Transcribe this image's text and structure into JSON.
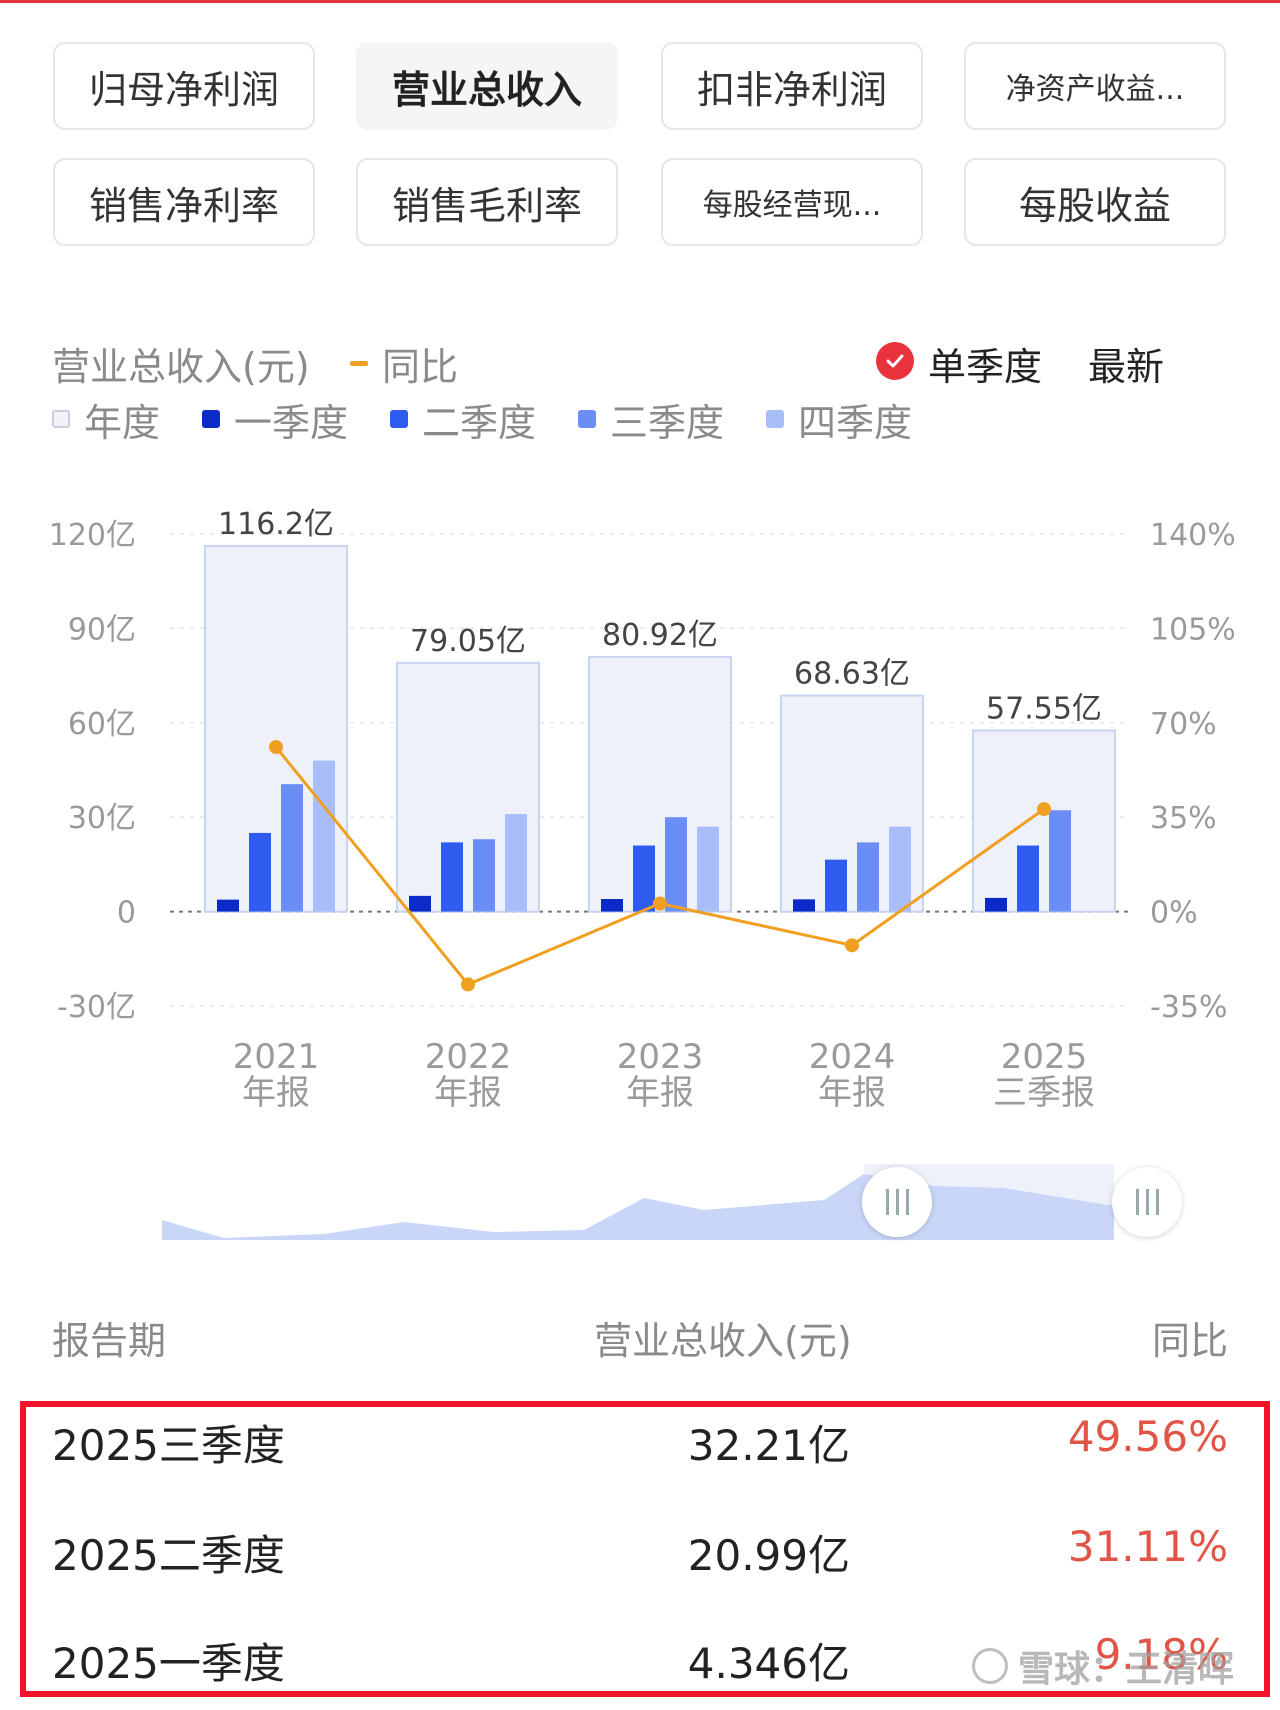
{
  "tabs": [
    {
      "label": "归母净利润",
      "active": false
    },
    {
      "label": "营业总收入",
      "active": true
    },
    {
      "label": "扣非净利润",
      "active": false
    },
    {
      "label": "净资产收益...",
      "active": false
    },
    {
      "label": "销售净利率",
      "active": false
    },
    {
      "label": "销售毛利率",
      "active": false
    },
    {
      "label": "每股经营现...",
      "active": false
    },
    {
      "label": "每股收益",
      "active": false
    }
  ],
  "chart_header": {
    "title": "营业总收入(元)",
    "line_legend": "同比",
    "single_quarter": "单季度",
    "latest": "最新"
  },
  "legend": [
    {
      "label": "年度",
      "color": "#eef0f8"
    },
    {
      "label": "一季度",
      "color": "#0a2bc8"
    },
    {
      "label": "二季度",
      "color": "#2f5cf0"
    },
    {
      "label": "三季度",
      "color": "#6b8ef5"
    },
    {
      "label": "四季度",
      "color": "#a9bdf9"
    }
  ],
  "chart_data": {
    "type": "bar",
    "categories": [
      {
        "year": "2021",
        "period": "年报"
      },
      {
        "year": "2022",
        "period": "年报"
      },
      {
        "year": "2023",
        "period": "年报"
      },
      {
        "year": "2024",
        "period": "年报"
      },
      {
        "year": "2025",
        "period": "三季报"
      }
    ],
    "annual_totals": [
      116.2,
      79.05,
      80.92,
      68.63,
      57.55
    ],
    "annual_total_labels": [
      "116.2亿",
      "79.05亿",
      "80.92亿",
      "68.63亿",
      "57.55亿"
    ],
    "series": [
      {
        "name": "一季度",
        "values": [
          3.8,
          5.0,
          4.0,
          3.9,
          4.346
        ]
      },
      {
        "name": "二季度",
        "values": [
          25,
          22,
          21,
          16.5,
          20.99
        ]
      },
      {
        "name": "三季度",
        "values": [
          40.5,
          23,
          30,
          22,
          32.21
        ]
      },
      {
        "name": "四季度",
        "values": [
          48,
          31,
          27,
          27,
          null
        ]
      }
    ],
    "line": {
      "name": "同比",
      "values": [
        61,
        -27,
        3,
        -12.5,
        38
      ],
      "color": "#f0a020"
    },
    "y_left": {
      "ticks": [
        "120亿",
        "90亿",
        "60亿",
        "30亿",
        "0",
        "-30亿"
      ],
      "range": [
        -30,
        120
      ],
      "unit": "亿"
    },
    "y_right": {
      "ticks": [
        "140%",
        "105%",
        "70%",
        "35%",
        "0%",
        "-35%"
      ],
      "range": [
        -35,
        140
      ]
    },
    "grid": true
  },
  "table": {
    "headers": [
      "报告期",
      "营业总收入(元)",
      "同比"
    ],
    "rows": [
      {
        "period": "2025三季度",
        "revenue": "32.21亿",
        "yoy": "49.56%"
      },
      {
        "period": "2025二季度",
        "revenue": "20.99亿",
        "yoy": "31.11%"
      },
      {
        "period": "2025一季度",
        "revenue": "4.346亿",
        "yoy": "9.18%"
      }
    ]
  },
  "watermark": "雪球：王清晖"
}
